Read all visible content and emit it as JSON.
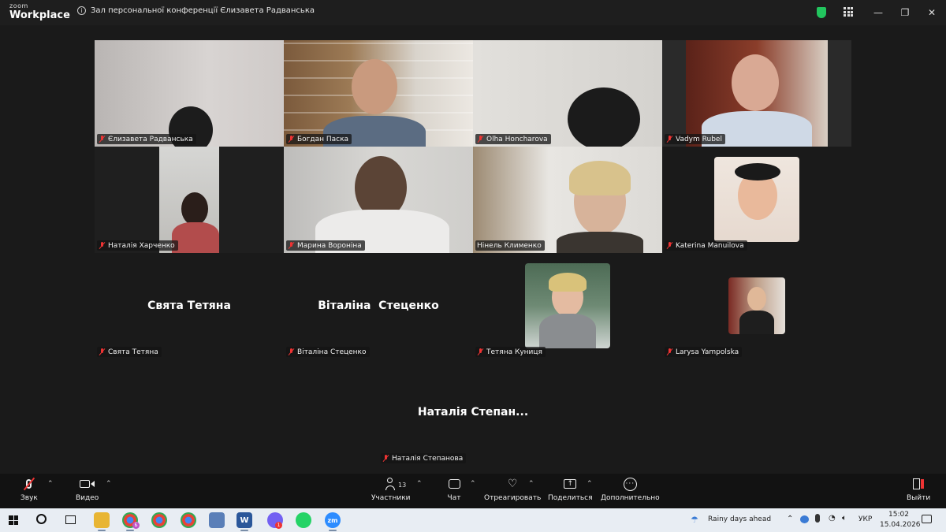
{
  "app": {
    "logo_line1": "zoom",
    "logo_line2": "Workplace",
    "meeting_title": "Зал персональної конференції Єлизавета Радванська"
  },
  "window_controls": {
    "minimize": "—",
    "restore": "❐",
    "close": "✕"
  },
  "participants": [
    {
      "name": "Єлизавета Радванська",
      "muted": true
    },
    {
      "name": "Богдан Паска",
      "muted": true
    },
    {
      "name": "Olha Honcharova",
      "muted": true
    },
    {
      "name": "Vadym Rubel",
      "muted": true
    },
    {
      "name": "Наталія Харченко",
      "muted": true
    },
    {
      "name": "Марина Вороніна",
      "muted": true
    },
    {
      "name": "Нінель Клименко",
      "muted": false,
      "active_speaker": true
    },
    {
      "name": "Katerina Manuilova",
      "muted": true
    },
    {
      "name": "Свята Тетяна",
      "display_name": "Свята Тетяна",
      "muted": true
    },
    {
      "name": "Віталіна Стеценко",
      "display_name": "Віталіна  Стеценко",
      "muted": true
    },
    {
      "name": "Тетяна Куниця",
      "muted": true
    },
    {
      "name": "Larysa Yampolska",
      "muted": true
    },
    {
      "name": "Наталія Степанова",
      "display_name": "Наталія Степан...",
      "muted": true
    }
  ],
  "toolbar": {
    "audio_label": "Звук",
    "video_label": "Видео",
    "participants_label": "Участники",
    "participants_count": "13",
    "chat_label": "Чат",
    "react_label": "Отреагировать",
    "share_label": "Поделиться",
    "more_label": "Дополнительно",
    "leave_label": "Выйти"
  },
  "taskbar": {
    "weather": "Rainy days ahead",
    "language": "УКР",
    "time": "15:02",
    "date": "15.04.2026",
    "chrome_badge": "Б",
    "viber_badge": "1"
  },
  "colors": {
    "active_speaker_border": "#4ade80",
    "muted_red": "#e33333",
    "shield_green": "#22c55e"
  }
}
